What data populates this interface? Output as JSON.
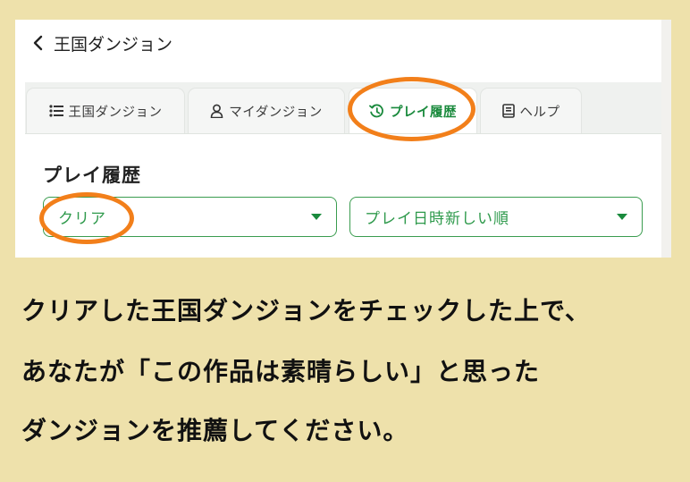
{
  "header": {
    "back_title": "王国ダンジョン"
  },
  "tabs": [
    {
      "label": "王国ダンジョン",
      "icon": "list-icon"
    },
    {
      "label": "マイダンジョン",
      "icon": "person-icon"
    },
    {
      "label": "プレイ履歴",
      "icon": "history-icon",
      "active": true
    },
    {
      "label": "ヘルプ",
      "icon": "book-icon"
    }
  ],
  "section": {
    "title": "プレイ履歴"
  },
  "filters": {
    "status": {
      "value": "クリア"
    },
    "sort": {
      "value": "プレイ日時新しい順"
    }
  },
  "caption": {
    "line1": "クリアした王国ダンジョンをチェックした上で、",
    "line2": "あなたが「この作品は素晴らしい」と思った",
    "line3": "ダンジョンを推薦してください。"
  },
  "colors": {
    "accent": "#1a8a3d",
    "highlight": "#f27f1a",
    "background": "#eee1ab"
  }
}
